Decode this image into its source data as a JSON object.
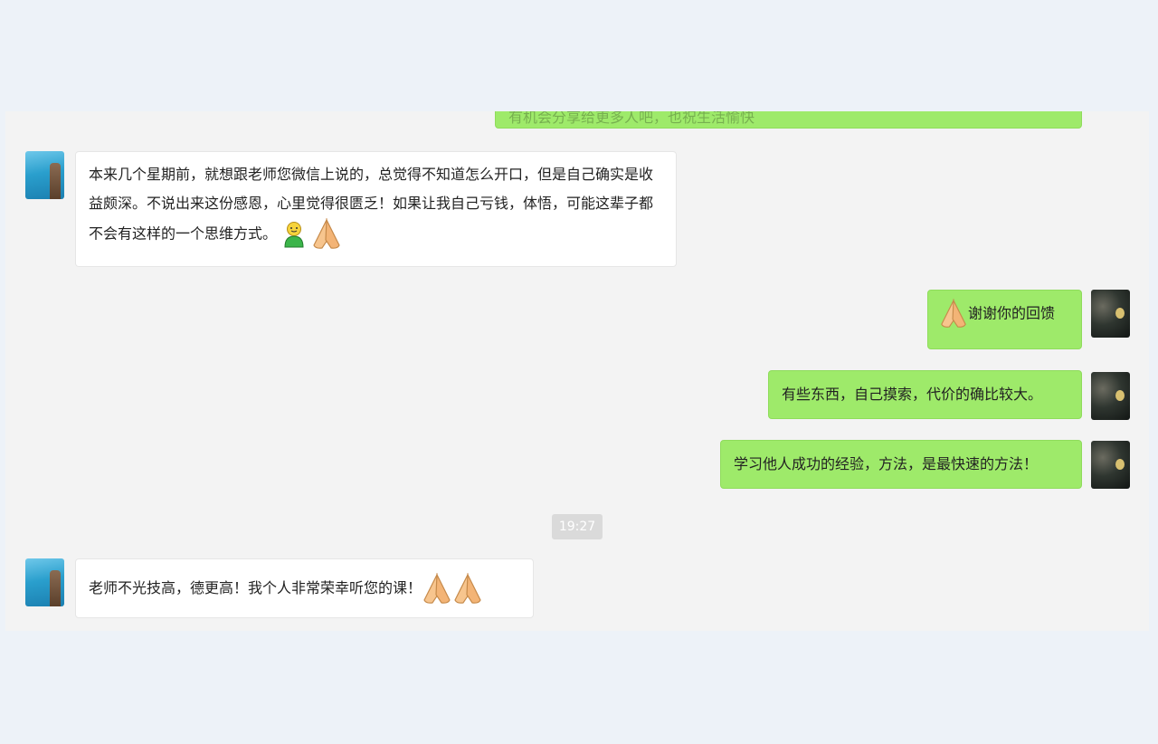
{
  "messages": {
    "partial_top": "有机会分享给更多人吧，也祝生活愉快",
    "incoming_1": "本来几个星期前，就想跟老师您微信上说的，总觉得不知道怎么开口，但是自己确实是收益颇深。不说出来这份感恩，心里觉得很匮乏！如果让我自己亏钱，体悟，可能这辈子都不会有这样的一个思维方式。",
    "outgoing_1": "谢谢你的回馈",
    "outgoing_2": "有些东西，自己摸索，代价的确比较大。",
    "outgoing_3": "学习他人成功的经验，方法，是最快速的方法！",
    "incoming_2": "老师不光技高，德更高！我个人非常荣幸听您的课！"
  },
  "timestamp": "19:27",
  "colors": {
    "page_bg": "#edf2f8",
    "panel_bg": "#f3f3f3",
    "outgoing_bubble": "#9eea6a",
    "incoming_bubble": "#ffffff"
  },
  "icons": {
    "incoming_1": [
      "person-emoji-icon",
      "folded-hands-emoji-icon"
    ],
    "outgoing_1": [
      "folded-hands-emoji-icon"
    ],
    "incoming_2": [
      "folded-hands-emoji-icon",
      "folded-hands-emoji-icon"
    ]
  }
}
